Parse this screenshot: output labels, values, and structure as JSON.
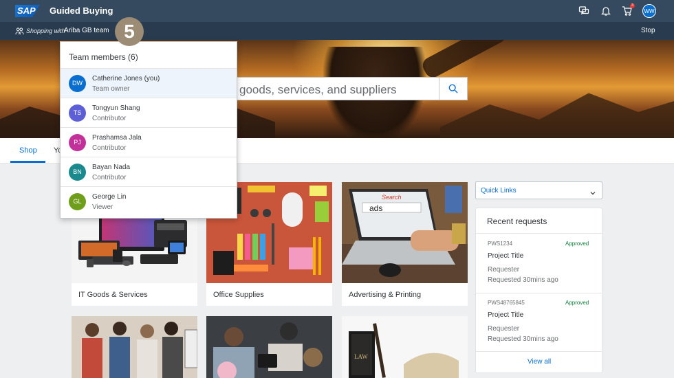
{
  "shell": {
    "logo": "SAP",
    "title": "Guided Buying",
    "cart_count": "3",
    "user_initials": "WW"
  },
  "teambar": {
    "prefix": "Shopping with",
    "team_name": "Ariba GB team",
    "stop_label": "Stop",
    "step_number": "5"
  },
  "search": {
    "placeholder": "goods, services, and suppliers"
  },
  "tabs": [
    {
      "label": "Shop",
      "active": true
    },
    {
      "label": "Yo",
      "active": false
    }
  ],
  "team_members": {
    "title": "Team members (6)",
    "items": [
      {
        "initials": "DW",
        "name": "Catherine Jones (you)",
        "role": "Team owner",
        "color": "#0a6ed1"
      },
      {
        "initials": "TS",
        "name": "Tongyun Shang",
        "role": "Contributor",
        "color": "#5d5fd6"
      },
      {
        "initials": "PJ",
        "name": "Prashamsa Jala",
        "role": "Contributor",
        "color": "#c2309a"
      },
      {
        "initials": "BN",
        "name": "Bayan Nada",
        "role": "Contributor",
        "color": "#1a8a8f"
      },
      {
        "initials": "GL",
        "name": "George Lin",
        "role": "Viewer",
        "color": "#6f9e1a"
      }
    ]
  },
  "categories": [
    {
      "label": "IT Goods & Services"
    },
    {
      "label": "Office Supplies"
    },
    {
      "label": "Advertising & Printing"
    }
  ],
  "quick_links": {
    "label": "Quick Links"
  },
  "recent_requests": {
    "title": "Recent requests",
    "items": [
      {
        "id": "PWS1234",
        "status": "Approved",
        "title": "Project Title",
        "requester": "Requester",
        "requested": "Requested 30mins ago"
      },
      {
        "id": "PWS48765845",
        "status": "Approved",
        "title": "Project Title",
        "requester": "Requester",
        "requested": "Requested 30mins ago"
      }
    ],
    "view_all": "View all"
  },
  "ad_search_text": "Search",
  "ad_typed_text": "ads",
  "book_spine_text": "LAW"
}
